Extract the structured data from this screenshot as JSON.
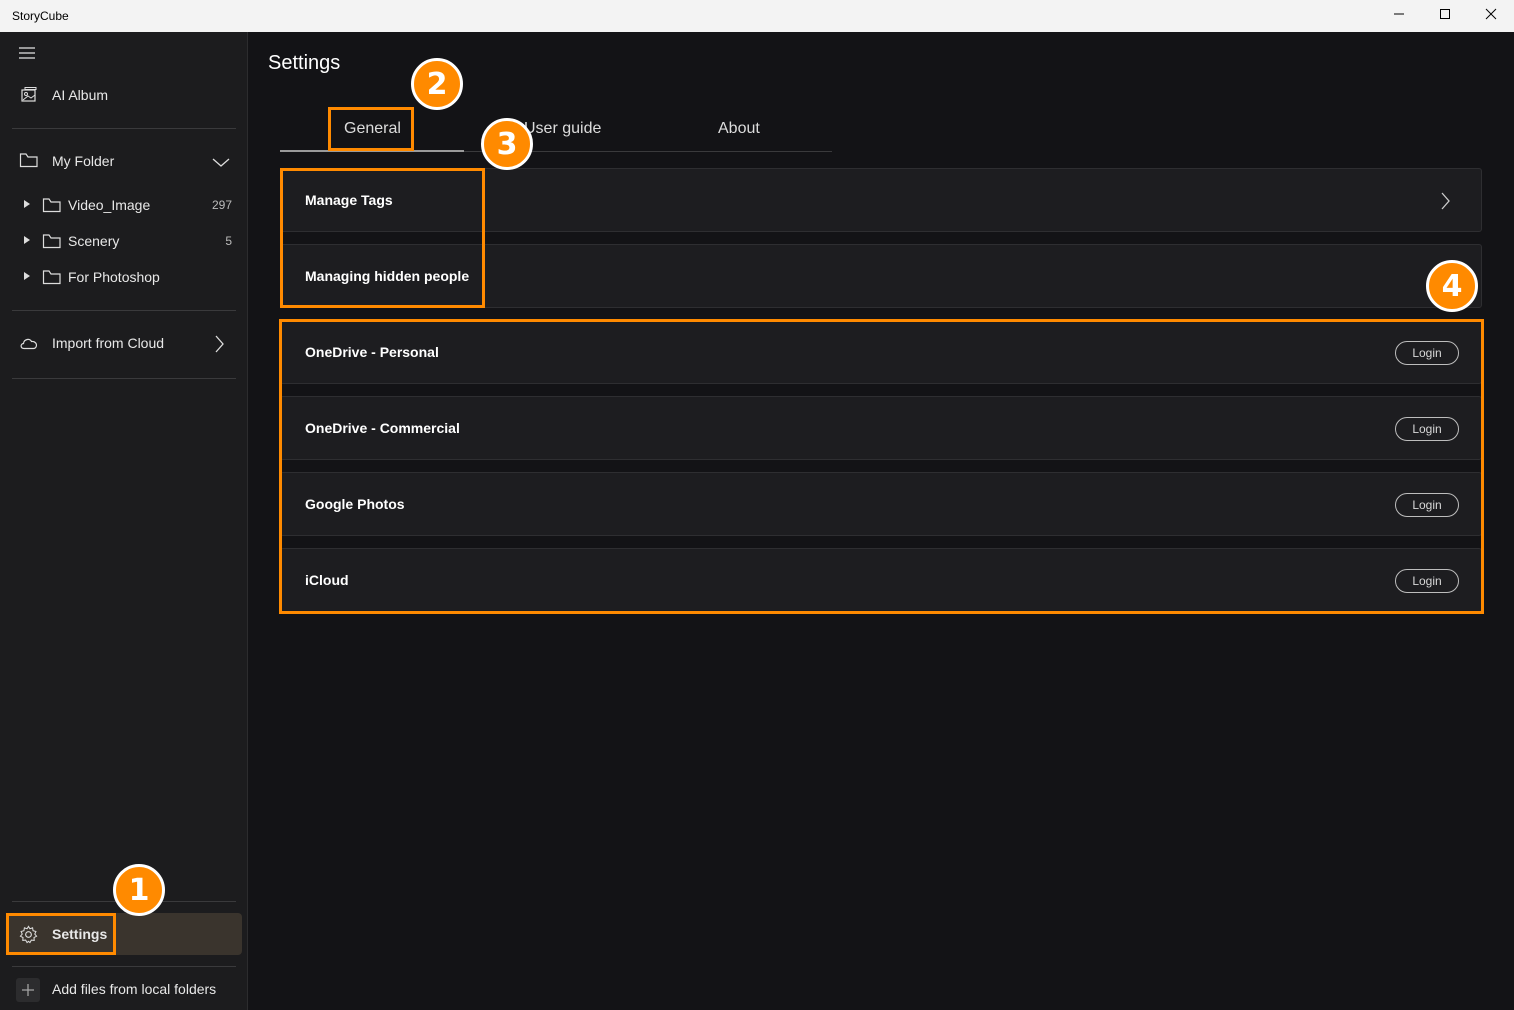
{
  "app": {
    "title": "StoryCube"
  },
  "window_controls": {
    "minimize_icon": "minimize-icon",
    "maximize_icon": "maximize-icon",
    "close_icon": "close-icon"
  },
  "sidebar": {
    "ai_album": "AI Album",
    "my_folder": "My Folder",
    "folders": [
      {
        "label": "Video_Image",
        "count": "297"
      },
      {
        "label": "Scenery",
        "count": "5"
      },
      {
        "label": "For Photoshop",
        "count": ""
      }
    ],
    "import_cloud": "Import from Cloud",
    "settings": "Settings",
    "add_files": "Add files from local folders"
  },
  "main": {
    "title": "Settings",
    "tabs": [
      {
        "label": "General"
      },
      {
        "label": "User guide"
      },
      {
        "label": "About"
      }
    ],
    "general_items": [
      {
        "label": "Manage Tags"
      },
      {
        "label": "Managing hidden people"
      }
    ],
    "cloud_accounts": [
      {
        "label": "OneDrive - Personal",
        "action": "Login"
      },
      {
        "label": "OneDrive - Commercial",
        "action": "Login"
      },
      {
        "label": "Google Photos",
        "action": "Login"
      },
      {
        "label": "iCloud",
        "action": "Login"
      }
    ]
  },
  "annotations": {
    "badge1": "1",
    "badge2": "2",
    "badge3": "3",
    "badge4": "4"
  },
  "colors": {
    "highlight": "#ff8a00",
    "background": "#131316",
    "sidebar": "#1c1c1e"
  }
}
